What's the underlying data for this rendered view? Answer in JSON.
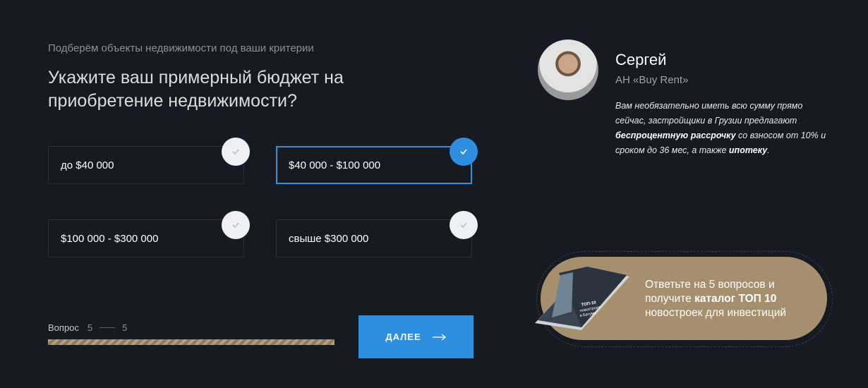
{
  "quiz": {
    "subtitle": "Подберём объекты недвижимости под ваши критерии",
    "question": "Укажите ваш примерный бюджет на приобретение недвижимости?",
    "options": [
      {
        "label": "до $40 000",
        "selected": false
      },
      {
        "label": "$40 000 - $100 000",
        "selected": true
      },
      {
        "label": "$100 000 - $300 000",
        "selected": false
      },
      {
        "label": "свыше $300 000",
        "selected": false
      }
    ],
    "progress": {
      "label": "Вопрос",
      "current": "5",
      "total": "5",
      "fraction": 1.0
    },
    "next_button": "ДАЛЕЕ"
  },
  "agent": {
    "name": "Сергей",
    "agency": "АН «Buy Rent»",
    "message_parts": {
      "p1": "Вам необязательно иметь всю сумму прямо сейчас, застройщики в Грузии предлагают ",
      "b1": "беспроцентную рассрочку",
      "p2": " со взносом от 10% и сроком до 36 мес, а также ",
      "b2": "ипотеку",
      "p3": "."
    }
  },
  "promo": {
    "line1": "Ответьте на 5 вопросов и получите ",
    "bold": "каталог ТОП 10",
    "line2": " новостроек для инвестиций",
    "book_cover_text": "ТОП-10 новостроек в Батуми"
  },
  "colors": {
    "background": "#161a23",
    "accent": "#2e8fe0",
    "promo": "#a68f6e"
  }
}
